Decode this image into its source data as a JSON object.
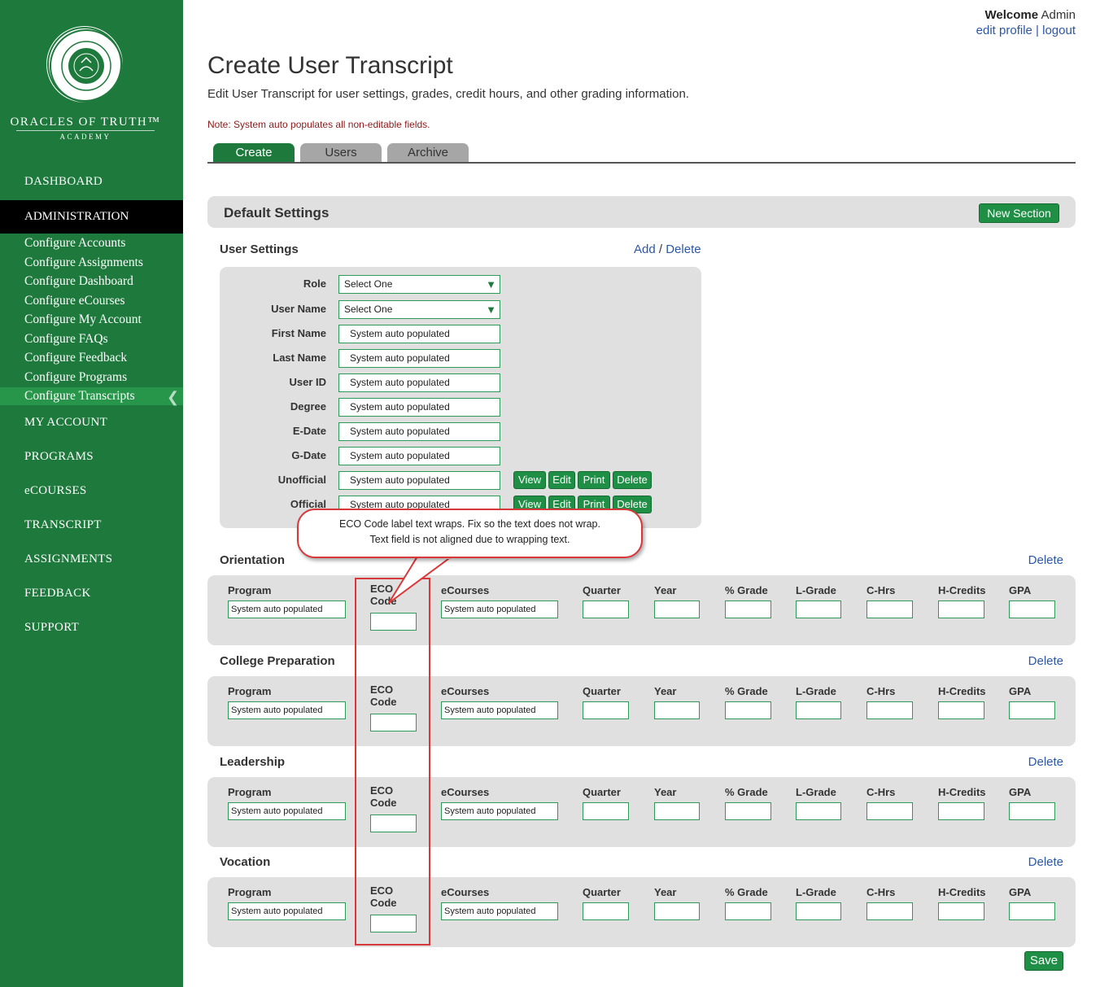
{
  "sidebar": {
    "brand_ring": "ORACLES OF TRUTH",
    "brand_name": "ORACLES OF TRUTH™",
    "brand_sub": "ACADEMY",
    "nav_dashboard": "DASHBOARD",
    "nav_administration": "ADMINISTRATION",
    "sub_items": [
      "Configure Accounts",
      "Configure Assignments",
      "Configure Dashboard",
      "Configure eCourses",
      "Configure My Account",
      "Configure FAQs",
      "Configure Feedback",
      "Configure Programs",
      "Configure Transcripts"
    ],
    "nav_bottom": [
      "MY ACCOUNT",
      "PROGRAMS",
      "eCOURSES",
      "TRANSCRIPT",
      "ASSIGNMENTS",
      "FEEDBACK",
      "SUPPORT"
    ]
  },
  "header": {
    "welcome": "Welcome",
    "user": "Admin",
    "edit_profile": "edit profile",
    "sep": "|",
    "logout": "logout"
  },
  "page": {
    "title": "Create User Transcript",
    "description": "Edit User Transcript for user settings, grades, credit hours, and other grading information.",
    "note": "Note: System auto populates all non-editable fields.",
    "tabs": [
      "Create",
      "Users",
      "Archive"
    ]
  },
  "default_settings": {
    "title": "Default Settings",
    "new_section": "New Section"
  },
  "user_settings": {
    "title": "User Settings",
    "add": "Add",
    "slash": "/",
    "delete": "Delete",
    "fields": [
      {
        "label": "Role",
        "value": "Select One"
      },
      {
        "label": "User Name",
        "value": "Select One"
      },
      {
        "label": "First Name",
        "value": "System auto populated"
      },
      {
        "label": "Last Name",
        "value": "System auto populated"
      },
      {
        "label": "User ID",
        "value": "System auto populated"
      },
      {
        "label": "Degree",
        "value": "System auto populated"
      },
      {
        "label": "E-Date",
        "value": "System auto populated"
      },
      {
        "label": "G-Date",
        "value": "System auto populated"
      },
      {
        "label": "Unofficial",
        "value": "System auto populated"
      },
      {
        "label": "Official",
        "value": "System auto populated"
      }
    ],
    "actions": [
      "View",
      "Edit",
      "Print",
      "Delete"
    ],
    "dropdown_arrow": "▼"
  },
  "sections": [
    {
      "title": "Orientation",
      "delete": "Delete"
    },
    {
      "title": "College Preparation",
      "delete": "Delete"
    },
    {
      "title": "Leadership",
      "delete": "Delete"
    },
    {
      "title": "Vocation",
      "delete": "Delete"
    }
  ],
  "columns": {
    "program": "Program",
    "eco_1": "ECO",
    "eco_2": "Code",
    "ecourses": "eCourses",
    "quarter": "Quarter",
    "year": "Year",
    "grade": "% Grade",
    "lgrade": "L-Grade",
    "chrs": "C-Hrs",
    "hcredits": "H-Credits",
    "gpa": "GPA",
    "auto_value": "System auto populated"
  },
  "annotation": {
    "line1": "ECO Code label text wraps. Fix so the text does not wrap.",
    "line2": "Text field is not aligned due to wrapping text."
  },
  "save": "Save",
  "colors": {
    "sidebar_green": "#1e7a3c",
    "button_green": "#1f8f46",
    "link_blue": "#2b57a8",
    "callout_red": "#d9383a"
  }
}
